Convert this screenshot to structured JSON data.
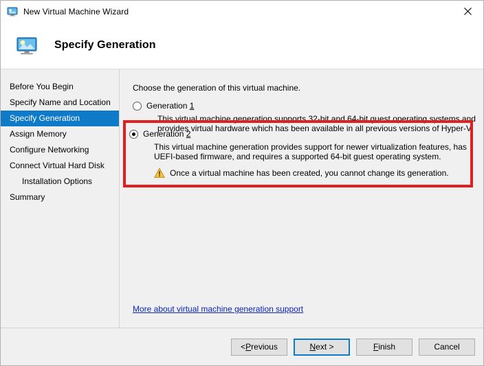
{
  "window": {
    "title": "New Virtual Machine Wizard",
    "icon": "virtual-machine-icon",
    "close_label": "✕"
  },
  "header": {
    "icon": "virtual-machine-icon",
    "title": "Specify Generation"
  },
  "sidebar": {
    "items": [
      {
        "label": "Before You Begin",
        "selected": false,
        "sub": false
      },
      {
        "label": "Specify Name and Location",
        "selected": false,
        "sub": false
      },
      {
        "label": "Specify Generation",
        "selected": true,
        "sub": false
      },
      {
        "label": "Assign Memory",
        "selected": false,
        "sub": false
      },
      {
        "label": "Configure Networking",
        "selected": false,
        "sub": false
      },
      {
        "label": "Connect Virtual Hard Disk",
        "selected": false,
        "sub": false
      },
      {
        "label": "Installation Options",
        "selected": false,
        "sub": true
      },
      {
        "label": "Summary",
        "selected": false,
        "sub": false
      }
    ]
  },
  "main": {
    "intro": "Choose the generation of this virtual machine.",
    "options": [
      {
        "label_prefix": "Generation ",
        "label_accesskey": "1",
        "checked": false,
        "description": "This virtual machine generation supports 32-bit and 64-bit guest operating systems and provides virtual hardware which has been available in all previous versions of Hyper-V."
      },
      {
        "label_prefix": "Generation ",
        "label_accesskey": "2",
        "checked": true,
        "description": "This virtual machine generation provides support for newer virtualization features, has UEFI-based firmware, and requires a supported 64-bit guest operating system."
      }
    ],
    "warning": {
      "icon": "warning-triangle-icon",
      "text": "Once a virtual machine has been created, you cannot change its generation."
    },
    "link": "More about virtual machine generation support",
    "highlight_color": "#e02020"
  },
  "footer": {
    "buttons": [
      {
        "prefix": "< ",
        "accesskey": "P",
        "suffix": "revious",
        "default": false
      },
      {
        "prefix": "",
        "accesskey": "N",
        "suffix": "ext >",
        "default": true
      },
      {
        "prefix": "",
        "accesskey": "F",
        "suffix": "inish",
        "default": false
      },
      {
        "prefix": "Cancel",
        "accesskey": "",
        "suffix": "",
        "default": false
      }
    ]
  },
  "colors": {
    "selection": "#0f7ac7",
    "link": "#0b24b5",
    "warning": "#f0b429",
    "highlight": "#e02020"
  }
}
